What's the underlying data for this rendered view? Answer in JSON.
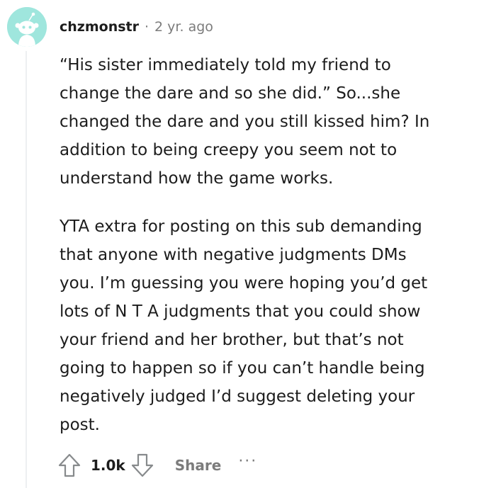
{
  "comment": {
    "username": "chzmonstr",
    "separator": "·",
    "time": "2 yr. ago",
    "paragraphs": [
      "“His sister immediately told my friend to\nchange the dare and so she did.” So...she\nchanged the dare and you still kissed him? In\naddition to being creepy you seem not to\nunderstand how the game works.",
      "YTA extra for posting on this sub demanding\nthat anyone with negative judgments DMs\nyou. I’m guessing you were hoping you’d get\nlots of N T A judgments that you could show\nyour friend and her brother, but that’s not\ngoing to happen so if you can’t handle being\nnegatively judged I’d suggest deleting your\npost."
    ],
    "score": "1.0k",
    "share_label": "Share",
    "more_label": "···"
  },
  "icons": {
    "avatar": "snoo-avatar-icon",
    "upvote": "upvote-arrow-icon",
    "downvote": "downvote-arrow-icon",
    "more": "more-options-icon"
  },
  "colors": {
    "avatar_bg": "#9fe6dd",
    "muted_text": "#7c7c7c",
    "thread_line": "#edeff1"
  }
}
